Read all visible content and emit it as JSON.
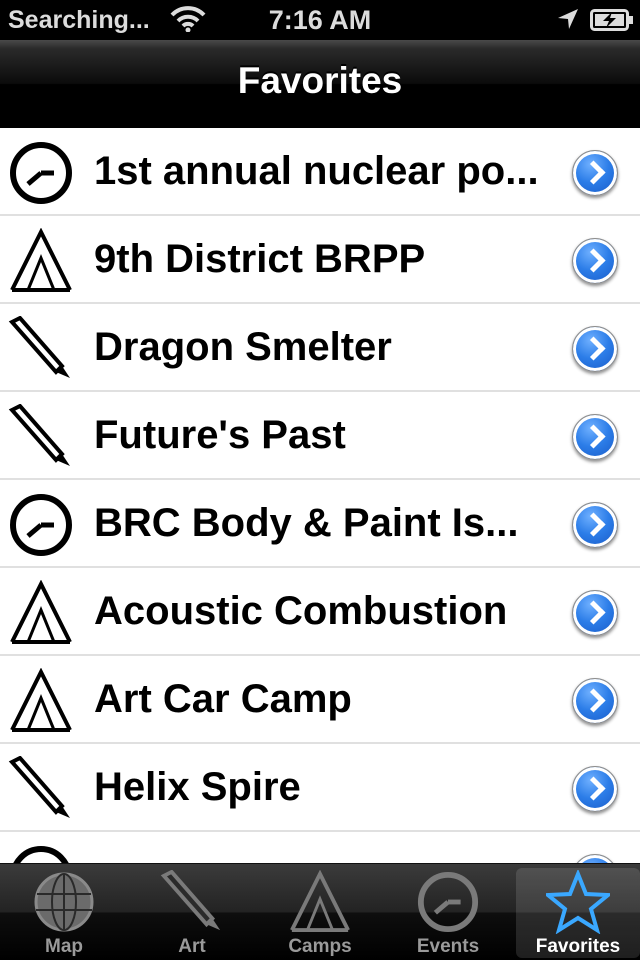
{
  "status_bar": {
    "carrier": "Searching...",
    "time": "7:16 AM"
  },
  "nav": {
    "title": "Favorites"
  },
  "favorites": [
    {
      "label": "1st annual nuclear po...",
      "icon": "clock-icon"
    },
    {
      "label": "9th District BRPP",
      "icon": "tent-icon"
    },
    {
      "label": "Dragon Smelter",
      "icon": "paintbrush-icon"
    },
    {
      "label": "Future's Past",
      "icon": "paintbrush-icon"
    },
    {
      "label": "BRC Body & Paint Is...",
      "icon": "clock-icon"
    },
    {
      "label": "Acoustic Combustion",
      "icon": "tent-icon"
    },
    {
      "label": "Art Car Camp",
      "icon": "tent-icon"
    },
    {
      "label": "Helix Spire",
      "icon": "paintbrush-icon"
    },
    {
      "label": "",
      "icon": "clock-icon"
    }
  ],
  "tabs": [
    {
      "label": "Map",
      "icon": "globe-icon"
    },
    {
      "label": "Art",
      "icon": "paintbrush-icon"
    },
    {
      "label": "Camps",
      "icon": "tent-icon"
    },
    {
      "label": "Events",
      "icon": "clock-icon"
    },
    {
      "label": "Favorites",
      "icon": "star-icon",
      "selected": true
    }
  ],
  "colors": {
    "accent_blue": "#2c7de8",
    "tab_inactive": "#9a9a9a"
  }
}
